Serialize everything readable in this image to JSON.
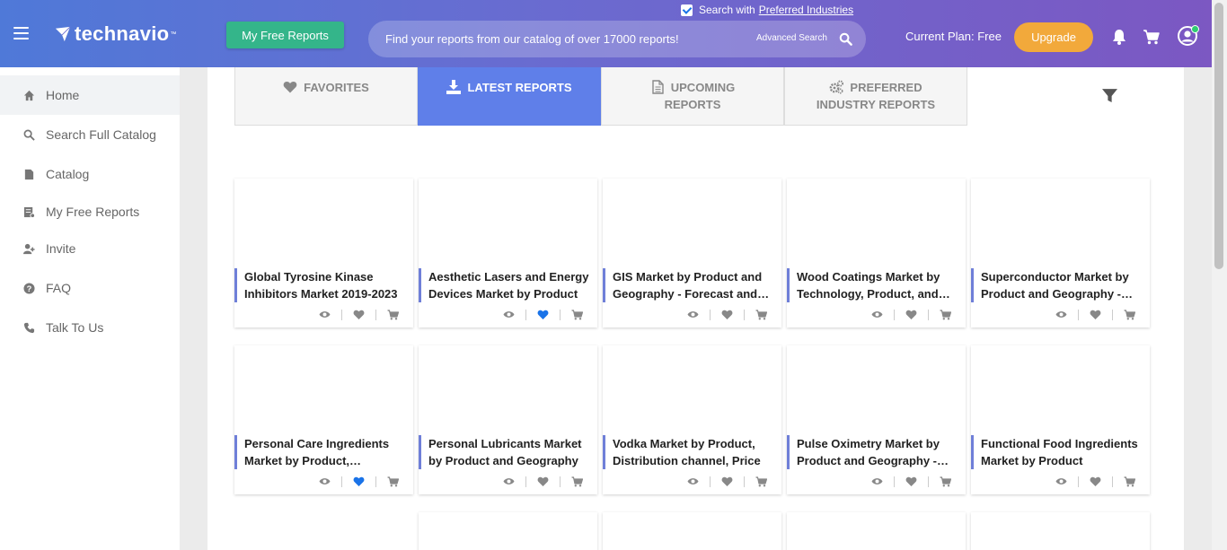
{
  "header": {
    "logo": "technavio",
    "logo_tm": "™",
    "free_reports_button": "My Free Reports",
    "preferred_search": {
      "prefix": "Search with",
      "link": "Preferred Industries",
      "checked": true
    },
    "search": {
      "placeholder": "Find your reports from our catalog of over 17000 reports!",
      "advanced_label": "Advanced Search"
    },
    "plan": "Current Plan: Free",
    "upgrade_button": "Upgrade"
  },
  "sidebar": {
    "items": [
      {
        "label": "Home",
        "icon": "home-icon",
        "active": true
      },
      {
        "label": "Search Full Catalog",
        "icon": "search-icon"
      },
      {
        "label": "Catalog",
        "icon": "document-icon"
      },
      {
        "label": "My Free Reports",
        "icon": "report-icon"
      },
      {
        "label": "Invite",
        "icon": "user-plus-icon"
      },
      {
        "label": "FAQ",
        "icon": "question-icon"
      },
      {
        "label": "Talk To Us",
        "icon": "phone-icon"
      }
    ]
  },
  "tabs": [
    {
      "line1": "FAVORITES",
      "line2": "",
      "icon": "heart-icon",
      "active": false
    },
    {
      "line1": "LATEST REPORTS",
      "line2": "",
      "icon": "download-icon",
      "active": true
    },
    {
      "line1": "UPCOMING",
      "line2": "REPORTS",
      "icon": "file-icon",
      "active": false
    },
    {
      "line1": "PREFERRED",
      "line2": "INDUSTRY REPORTS",
      "icon": "cogs-icon",
      "active": false
    }
  ],
  "reports": [
    {
      "title": "Global Tyrosine Kinase Inhibitors Market 2019-2023",
      "favorited": false
    },
    {
      "title": "Aesthetic Lasers and Energy Devices Market by Product",
      "favorited": true
    },
    {
      "title": "GIS Market by Product and Geography - Forecast and Analysis",
      "favorited": false
    },
    {
      "title": "Wood Coatings Market by Technology, Product, and Geography",
      "favorited": false
    },
    {
      "title": "Superconductor Market by Product and Geography - Forecast",
      "favorited": false
    },
    {
      "title": "Personal Care Ingredients Market by Product, Application",
      "favorited": true
    },
    {
      "title": "Personal Lubricants Market by Product and Geography",
      "favorited": false
    },
    {
      "title": "Vodka Market by Product, Distribution channel, Price",
      "favorited": false
    },
    {
      "title": "Pulse Oximetry Market by Product and Geography - Forecast",
      "favorited": false
    },
    {
      "title": "Functional Food Ingredients Market by Product",
      "favorited": false
    }
  ],
  "colors": {
    "accent": "#5f7fe9",
    "favorite_active": "#1a73e8",
    "favorite_inactive": "#888888",
    "free_button": "#34b58a",
    "upgrade_button": "#f2a93b"
  }
}
